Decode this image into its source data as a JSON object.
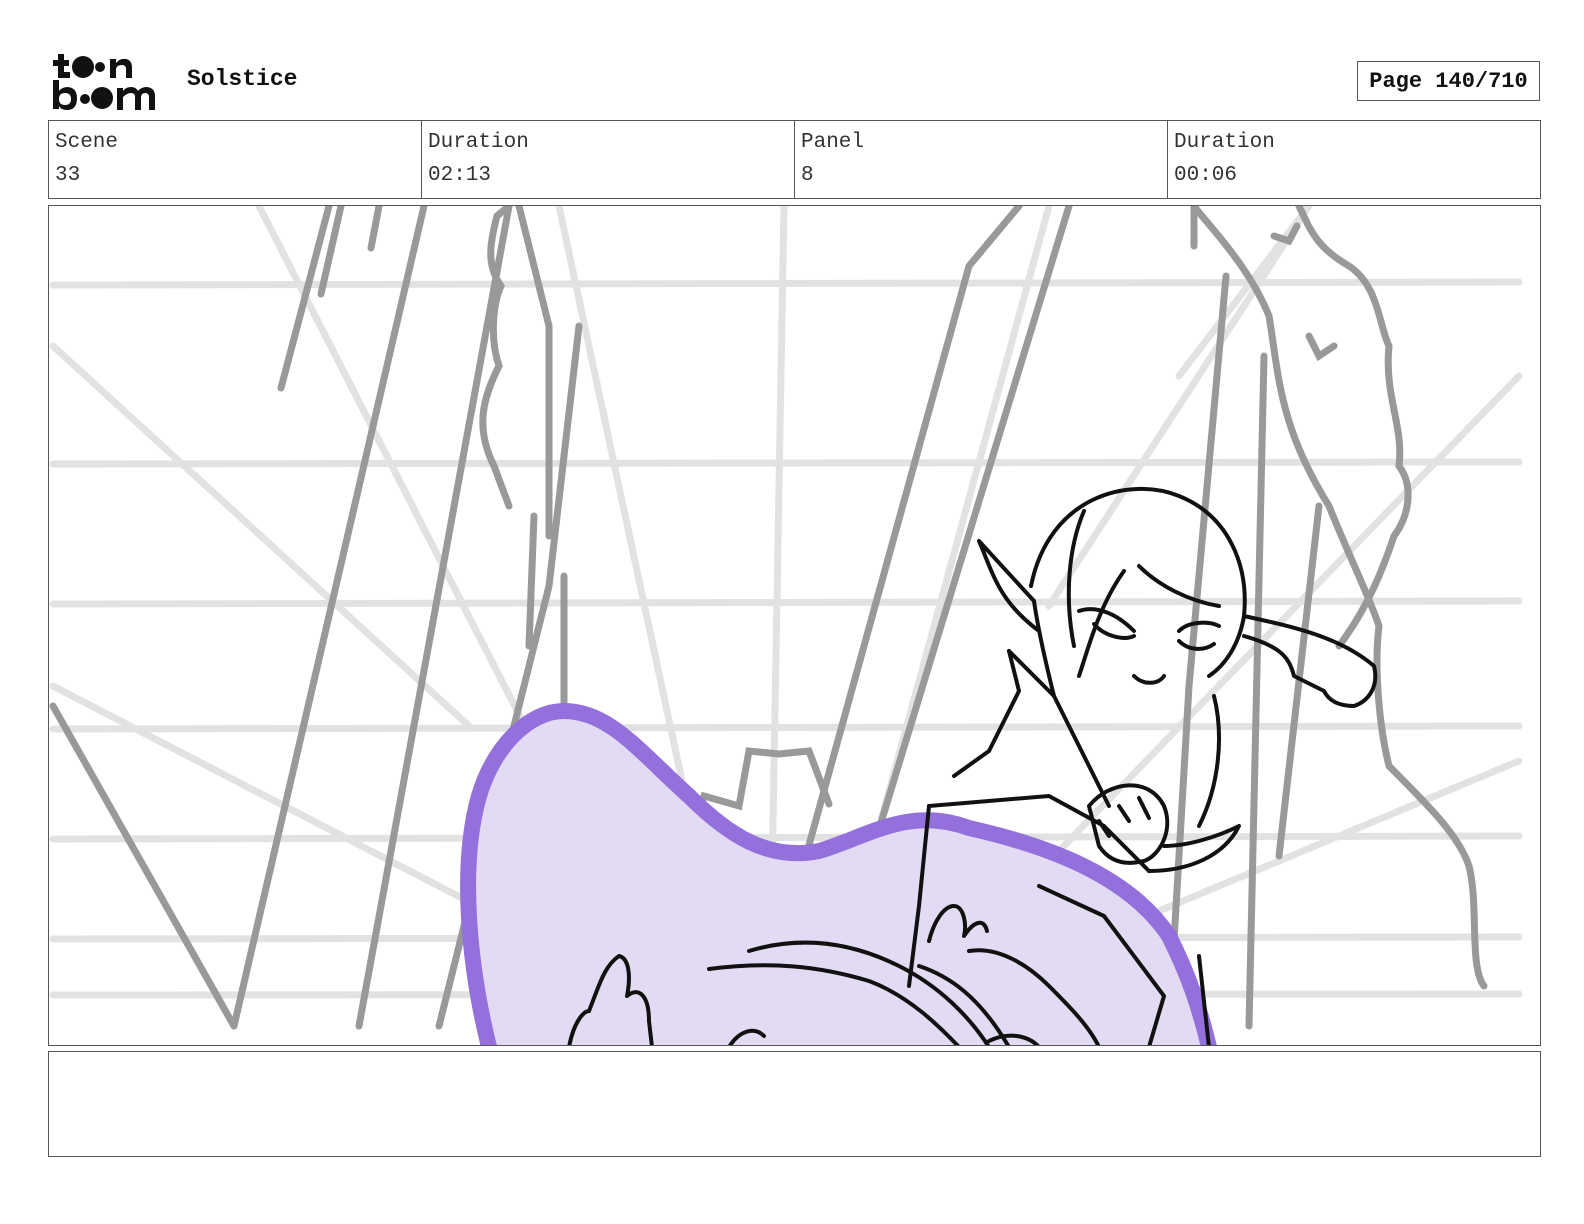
{
  "header": {
    "logo_name": "toon boom",
    "project_title": "Solstice",
    "page_label": "Page 140/710"
  },
  "info": [
    {
      "label": "Scene",
      "value": "33"
    },
    {
      "label": "Duration",
      "value": "02:13"
    },
    {
      "label": "Panel",
      "value": "8"
    },
    {
      "label": "Duration",
      "value": "00:06"
    }
  ],
  "panel": {
    "description_icon": "storyboard-sketch",
    "highlight_color": "#9370db",
    "highlight_fill": "#e3dbf3"
  },
  "notes": {
    "text": ""
  }
}
